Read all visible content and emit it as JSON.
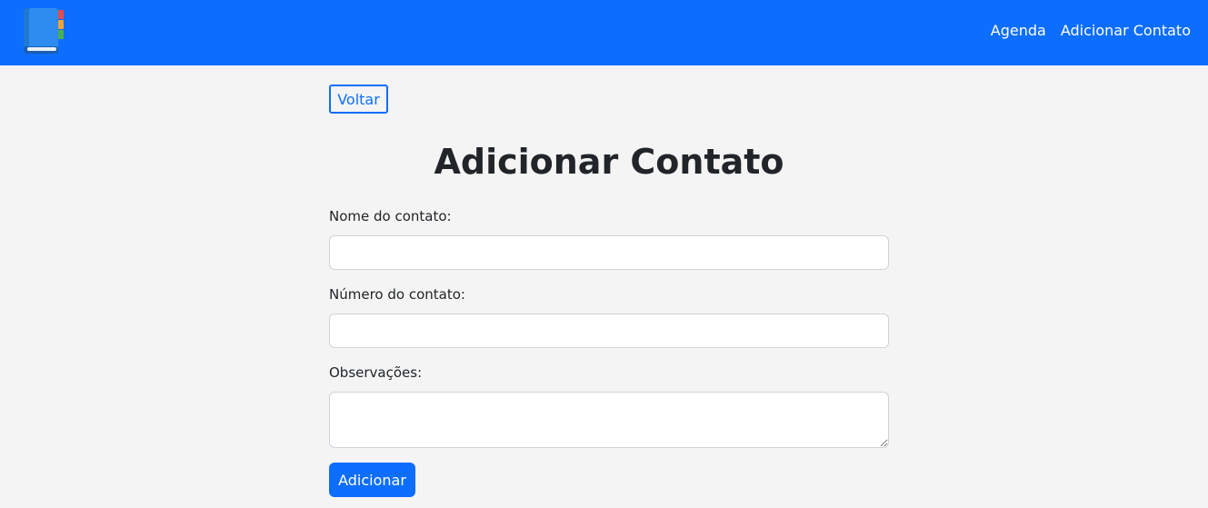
{
  "navbar": {
    "logo_icon": "address-book-icon",
    "links": [
      {
        "label": "Agenda"
      },
      {
        "label": "Adicionar Contato"
      }
    ],
    "background": "#0d6efd"
  },
  "main": {
    "back_label": "Voltar",
    "title": "Adicionar Contato",
    "fields": {
      "name_label": "Nome do contato:",
      "name_value": "",
      "number_label": "Número do contato:",
      "number_value": "",
      "notes_label": "Observações:",
      "notes_value": ""
    },
    "submit_label": "Adicionar",
    "accent": "#0d6efd"
  }
}
